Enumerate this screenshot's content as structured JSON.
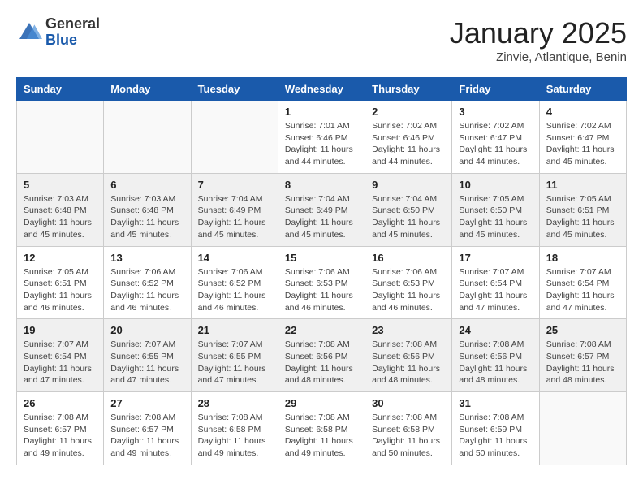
{
  "header": {
    "logo_general": "General",
    "logo_blue": "Blue",
    "title": "January 2025",
    "subtitle": "Zinvie, Atlantique, Benin"
  },
  "calendar": {
    "days_of_week": [
      "Sunday",
      "Monday",
      "Tuesday",
      "Wednesday",
      "Thursday",
      "Friday",
      "Saturday"
    ],
    "weeks": [
      [
        {
          "day": "",
          "sunrise": "",
          "sunset": "",
          "daylight": "",
          "empty": true
        },
        {
          "day": "",
          "sunrise": "",
          "sunset": "",
          "daylight": "",
          "empty": true
        },
        {
          "day": "",
          "sunrise": "",
          "sunset": "",
          "daylight": "",
          "empty": true
        },
        {
          "day": "1",
          "sunrise": "Sunrise: 7:01 AM",
          "sunset": "Sunset: 6:46 PM",
          "daylight": "Daylight: 11 hours and 44 minutes.",
          "empty": false
        },
        {
          "day": "2",
          "sunrise": "Sunrise: 7:02 AM",
          "sunset": "Sunset: 6:46 PM",
          "daylight": "Daylight: 11 hours and 44 minutes.",
          "empty": false
        },
        {
          "day": "3",
          "sunrise": "Sunrise: 7:02 AM",
          "sunset": "Sunset: 6:47 PM",
          "daylight": "Daylight: 11 hours and 44 minutes.",
          "empty": false
        },
        {
          "day": "4",
          "sunrise": "Sunrise: 7:02 AM",
          "sunset": "Sunset: 6:47 PM",
          "daylight": "Daylight: 11 hours and 45 minutes.",
          "empty": false
        }
      ],
      [
        {
          "day": "5",
          "sunrise": "Sunrise: 7:03 AM",
          "sunset": "Sunset: 6:48 PM",
          "daylight": "Daylight: 11 hours and 45 minutes.",
          "empty": false
        },
        {
          "day": "6",
          "sunrise": "Sunrise: 7:03 AM",
          "sunset": "Sunset: 6:48 PM",
          "daylight": "Daylight: 11 hours and 45 minutes.",
          "empty": false
        },
        {
          "day": "7",
          "sunrise": "Sunrise: 7:04 AM",
          "sunset": "Sunset: 6:49 PM",
          "daylight": "Daylight: 11 hours and 45 minutes.",
          "empty": false
        },
        {
          "day": "8",
          "sunrise": "Sunrise: 7:04 AM",
          "sunset": "Sunset: 6:49 PM",
          "daylight": "Daylight: 11 hours and 45 minutes.",
          "empty": false
        },
        {
          "day": "9",
          "sunrise": "Sunrise: 7:04 AM",
          "sunset": "Sunset: 6:50 PM",
          "daylight": "Daylight: 11 hours and 45 minutes.",
          "empty": false
        },
        {
          "day": "10",
          "sunrise": "Sunrise: 7:05 AM",
          "sunset": "Sunset: 6:50 PM",
          "daylight": "Daylight: 11 hours and 45 minutes.",
          "empty": false
        },
        {
          "day": "11",
          "sunrise": "Sunrise: 7:05 AM",
          "sunset": "Sunset: 6:51 PM",
          "daylight": "Daylight: 11 hours and 45 minutes.",
          "empty": false
        }
      ],
      [
        {
          "day": "12",
          "sunrise": "Sunrise: 7:05 AM",
          "sunset": "Sunset: 6:51 PM",
          "daylight": "Daylight: 11 hours and 46 minutes.",
          "empty": false
        },
        {
          "day": "13",
          "sunrise": "Sunrise: 7:06 AM",
          "sunset": "Sunset: 6:52 PM",
          "daylight": "Daylight: 11 hours and 46 minutes.",
          "empty": false
        },
        {
          "day": "14",
          "sunrise": "Sunrise: 7:06 AM",
          "sunset": "Sunset: 6:52 PM",
          "daylight": "Daylight: 11 hours and 46 minutes.",
          "empty": false
        },
        {
          "day": "15",
          "sunrise": "Sunrise: 7:06 AM",
          "sunset": "Sunset: 6:53 PM",
          "daylight": "Daylight: 11 hours and 46 minutes.",
          "empty": false
        },
        {
          "day": "16",
          "sunrise": "Sunrise: 7:06 AM",
          "sunset": "Sunset: 6:53 PM",
          "daylight": "Daylight: 11 hours and 46 minutes.",
          "empty": false
        },
        {
          "day": "17",
          "sunrise": "Sunrise: 7:07 AM",
          "sunset": "Sunset: 6:54 PM",
          "daylight": "Daylight: 11 hours and 47 minutes.",
          "empty": false
        },
        {
          "day": "18",
          "sunrise": "Sunrise: 7:07 AM",
          "sunset": "Sunset: 6:54 PM",
          "daylight": "Daylight: 11 hours and 47 minutes.",
          "empty": false
        }
      ],
      [
        {
          "day": "19",
          "sunrise": "Sunrise: 7:07 AM",
          "sunset": "Sunset: 6:54 PM",
          "daylight": "Daylight: 11 hours and 47 minutes.",
          "empty": false
        },
        {
          "day": "20",
          "sunrise": "Sunrise: 7:07 AM",
          "sunset": "Sunset: 6:55 PM",
          "daylight": "Daylight: 11 hours and 47 minutes.",
          "empty": false
        },
        {
          "day": "21",
          "sunrise": "Sunrise: 7:07 AM",
          "sunset": "Sunset: 6:55 PM",
          "daylight": "Daylight: 11 hours and 47 minutes.",
          "empty": false
        },
        {
          "day": "22",
          "sunrise": "Sunrise: 7:08 AM",
          "sunset": "Sunset: 6:56 PM",
          "daylight": "Daylight: 11 hours and 48 minutes.",
          "empty": false
        },
        {
          "day": "23",
          "sunrise": "Sunrise: 7:08 AM",
          "sunset": "Sunset: 6:56 PM",
          "daylight": "Daylight: 11 hours and 48 minutes.",
          "empty": false
        },
        {
          "day": "24",
          "sunrise": "Sunrise: 7:08 AM",
          "sunset": "Sunset: 6:56 PM",
          "daylight": "Daylight: 11 hours and 48 minutes.",
          "empty": false
        },
        {
          "day": "25",
          "sunrise": "Sunrise: 7:08 AM",
          "sunset": "Sunset: 6:57 PM",
          "daylight": "Daylight: 11 hours and 48 minutes.",
          "empty": false
        }
      ],
      [
        {
          "day": "26",
          "sunrise": "Sunrise: 7:08 AM",
          "sunset": "Sunset: 6:57 PM",
          "daylight": "Daylight: 11 hours and 49 minutes.",
          "empty": false
        },
        {
          "day": "27",
          "sunrise": "Sunrise: 7:08 AM",
          "sunset": "Sunset: 6:57 PM",
          "daylight": "Daylight: 11 hours and 49 minutes.",
          "empty": false
        },
        {
          "day": "28",
          "sunrise": "Sunrise: 7:08 AM",
          "sunset": "Sunset: 6:58 PM",
          "daylight": "Daylight: 11 hours and 49 minutes.",
          "empty": false
        },
        {
          "day": "29",
          "sunrise": "Sunrise: 7:08 AM",
          "sunset": "Sunset: 6:58 PM",
          "daylight": "Daylight: 11 hours and 49 minutes.",
          "empty": false
        },
        {
          "day": "30",
          "sunrise": "Sunrise: 7:08 AM",
          "sunset": "Sunset: 6:58 PM",
          "daylight": "Daylight: 11 hours and 50 minutes.",
          "empty": false
        },
        {
          "day": "31",
          "sunrise": "Sunrise: 7:08 AM",
          "sunset": "Sunset: 6:59 PM",
          "daylight": "Daylight: 11 hours and 50 minutes.",
          "empty": false
        },
        {
          "day": "",
          "sunrise": "",
          "sunset": "",
          "daylight": "",
          "empty": true
        }
      ]
    ]
  }
}
